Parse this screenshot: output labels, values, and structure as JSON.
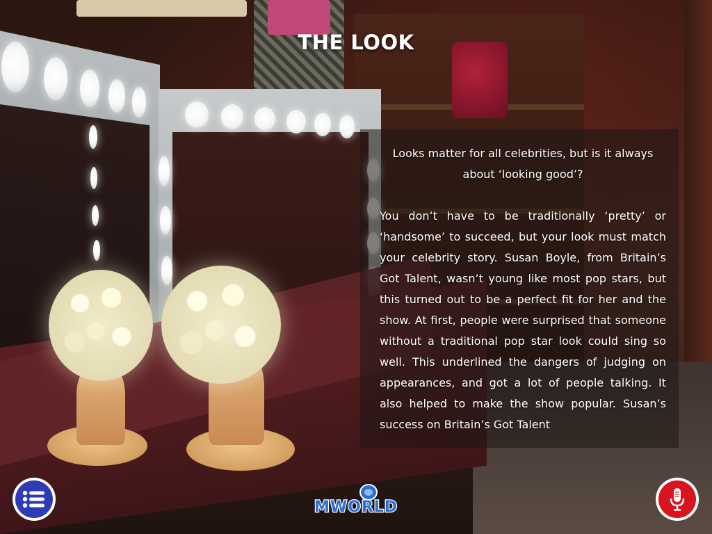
{
  "page": {
    "title": "THE LOOK"
  },
  "panel": {
    "intro": "Looks matter for all celebrities, but is it always about ‘looking good’?",
    "body": "You don’t have to be traditionally ‘pretty’ or ‘handsome’ to succeed, but your look must match your celebrity story.  Susan Boyle, from Britain’s Got Talent, wasn’t young like most pop stars, but this turned out to be a perfect fit for her and the show.  At first, people were surprised that someone without a traditional pop star look could sing so well.  This underlined the dangers of judging on appearances, and got a lot of people talking.  It also helped to make the show popular.  Susan’s success on Britain’s Got Talent"
  },
  "footer": {
    "menu_icon": "list-menu-icon",
    "logo_text": "MWORLD",
    "mic_icon": "microphone-icon"
  },
  "colors": {
    "menu_button": "#2d3bb5",
    "mic_button": "#d8151f",
    "logo_blue": "#2c6fd6"
  }
}
